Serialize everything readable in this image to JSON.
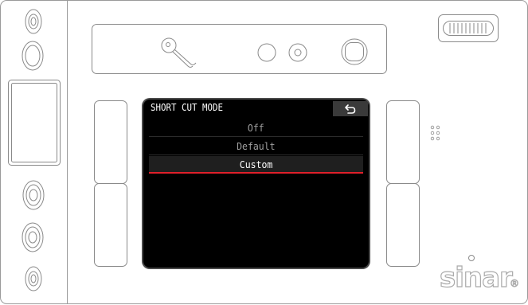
{
  "menu": {
    "title": "SHORT CUT MODE",
    "items": [
      {
        "label": "Off",
        "state": "unselected"
      },
      {
        "label": "Default",
        "state": "unselected"
      },
      {
        "label": "Custom",
        "state": "selected"
      }
    ]
  },
  "brand": {
    "logo_text": "sinar",
    "registered_mark": "®"
  },
  "colors": {
    "selection_underline": "#e0202a",
    "screen_background": "#000000",
    "body_outline": "#9a9a9a"
  },
  "icons": {
    "back": "return-arrow-icon",
    "key": "key-icon",
    "top_ring": "ring-button-icon",
    "top_circle": "circle-button-icon",
    "top_square": "rounded-square-button-icon",
    "grip": "grip-icon"
  }
}
